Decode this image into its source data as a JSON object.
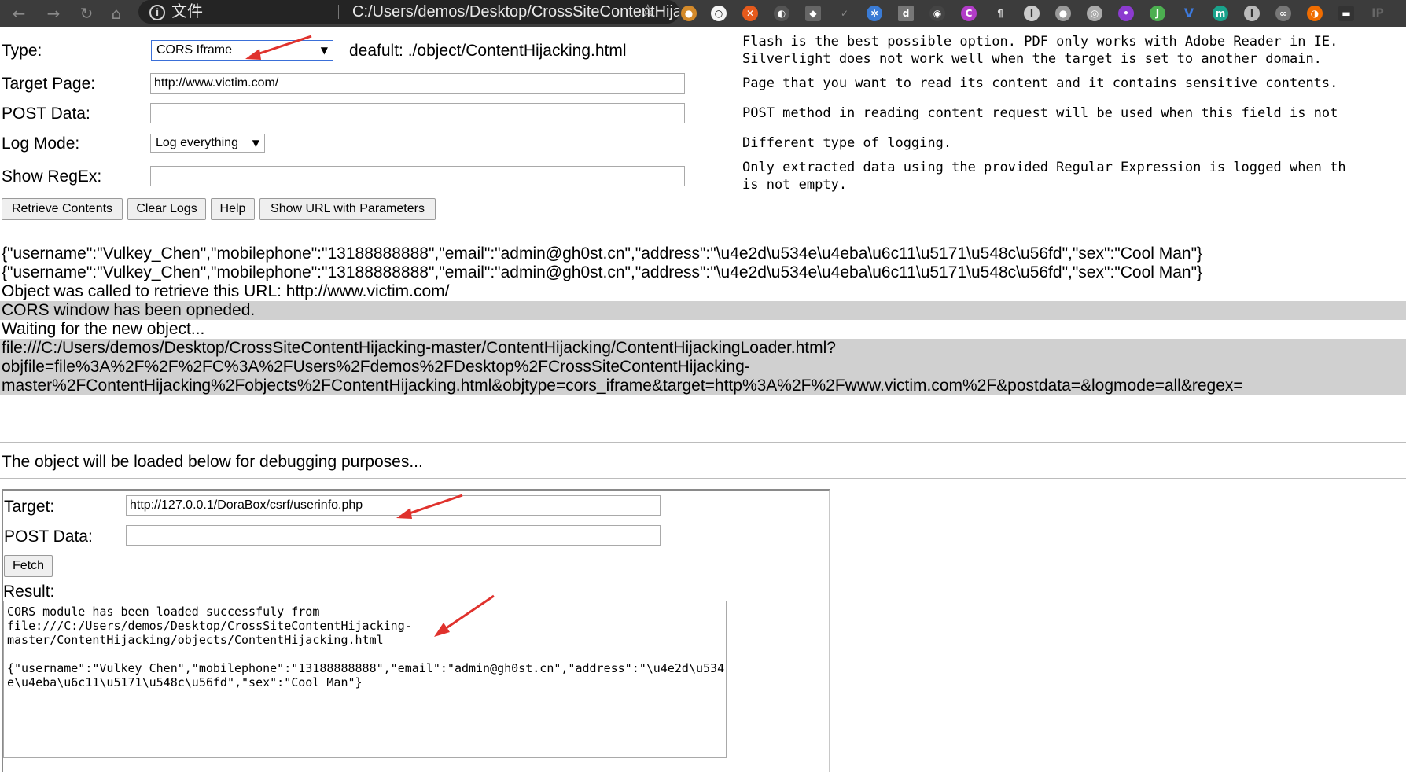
{
  "browser": {
    "back_icon": "back-arrow-icon",
    "forward_icon": "forward-arrow-icon",
    "reload_icon": "reload-icon",
    "home_icon": "home-icon",
    "scheme_label": "文件",
    "url": "C:/Users/demos/Desktop/CrossSiteContentHijacking-m..."
  },
  "form": {
    "type_label": "Type:",
    "type_value": "CORS Iframe",
    "type_default": "deafult:  ./object/ContentHijacking.html",
    "target_label": "Target Page:",
    "target_value": "http://www.victim.com/",
    "post_label": "POST Data:",
    "post_value": "",
    "log_label": "Log Mode:",
    "log_value": "Log everything",
    "regex_label": "Show RegEx:",
    "regex_value": ""
  },
  "descriptions": {
    "type_line1": "Flash is the best possible option. PDF only works with Adobe Reader in IE.",
    "type_line2": "Silverlight does not work well when the target is set to another domain.",
    "target": "Page that you want to read its content and it contains sensitive contents.",
    "post": "POST method in reading content request will be used when this field is not",
    "log": "Different type of logging.",
    "regex_line1": "Only extracted data using the provided Regular Expression is logged when th",
    "regex_line2": "is not empty."
  },
  "buttons": {
    "retrieve": "Retrieve Contents",
    "clear": "Clear Logs",
    "help": "Help",
    "show_url": "Show URL with Parameters"
  },
  "log_lines": [
    "{\"username\":\"Vulkey_Chen\",\"mobilephone\":\"13188888888\",\"email\":\"admin@gh0st.cn\",\"address\":\"\\u4e2d\\u534e\\u4eba\\u6c11\\u5171\\u548c\\u56fd\",\"sex\":\"Cool Man\"}",
    "{\"username\":\"Vulkey_Chen\",\"mobilephone\":\"13188888888\",\"email\":\"admin@gh0st.cn\",\"address\":\"\\u4e2d\\u534e\\u4eba\\u6c11\\u5171\\u548c\\u56fd\",\"sex\":\"Cool Man\"}",
    "Object was called to retrieve this URL: http://www.victim.com/",
    "CORS window has been opneded.",
    "Waiting for the new object...",
    "file:///C:/Users/demos/Desktop/CrossSiteContentHijacking-master/ContentHijacking/ContentHijackingLoader.html?",
    "objfile=file%3A%2F%2F%2FC%3A%2FUsers%2Fdemos%2FDesktop%2FCrossSiteContentHijacking-",
    "master%2FContentHijacking%2Fobjects%2FContentHijacking.html&objtype=cors_iframe&target=http%3A%2F%2Fwww.victim.com%2F&postdata=&logmode=all&regex="
  ],
  "debug_note": "The object will be loaded below for debugging purposes...",
  "frame": {
    "target_label": "Target:",
    "target_value": "http://127.0.0.1/DoraBox/csrf/userinfo.php",
    "post_label": "POST Data:",
    "post_value": "",
    "fetch_button": "Fetch",
    "result_label": "Result:",
    "result_text": "CORS module has been loaded successfuly from\nfile:///C:/Users/demos/Desktop/CrossSiteContentHijacking-\nmaster/ContentHijacking/objects/ContentHijacking.html\n\n{\"username\":\"Vulkey_Chen\",\"mobilephone\":\"13188888888\",\"email\":\"admin@gh0st.cn\",\"address\":\"\\u4e2d\\u534\ne\\u4eba\\u6c11\\u5171\\u548c\\u56fd\",\"sex\":\"Cool Man\"}"
  },
  "colors": {
    "chrome_bg": "#3c3c3c",
    "highlight": "#d0d0d0",
    "annotation_arrow": "#e0322d"
  }
}
